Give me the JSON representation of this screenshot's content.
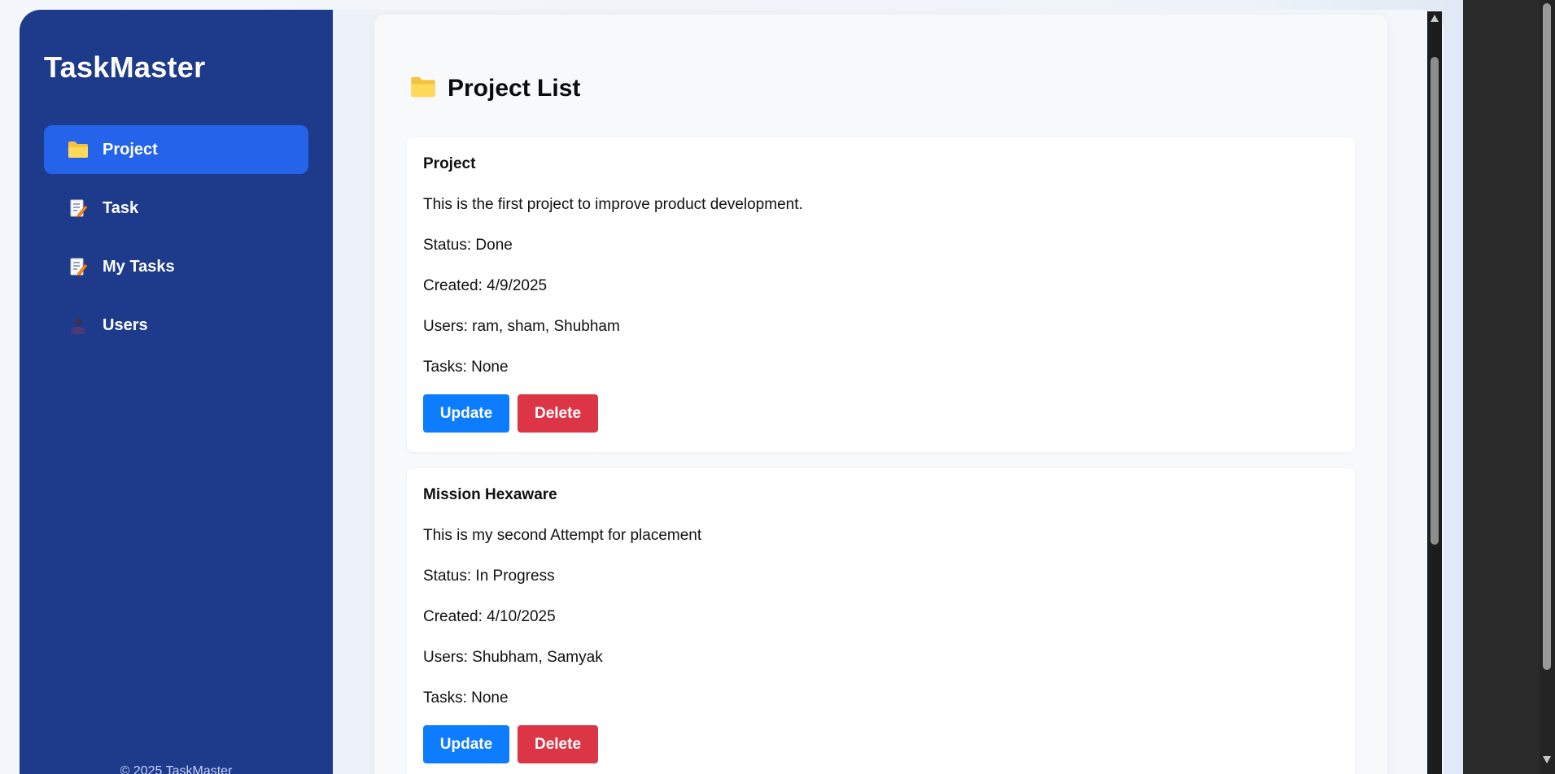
{
  "app": {
    "title": "TaskMaster",
    "footer": "© 2025 TaskMaster"
  },
  "sidebar": {
    "items": [
      {
        "label": "Project",
        "icon": "folder-icon",
        "active": true
      },
      {
        "label": "Task",
        "icon": "memo-icon",
        "active": false
      },
      {
        "label": "My Tasks",
        "icon": "memo-icon",
        "active": false
      },
      {
        "label": "Users",
        "icon": "user-icon",
        "active": false
      }
    ]
  },
  "main": {
    "heading": "Project List",
    "heading_icon": "folder-icon",
    "projects": [
      {
        "name": "Project",
        "description": "This is the first project to improve product development.",
        "status": "Status: Done",
        "created": "Created: 4/9/2025",
        "users": "Users: ram, sham, Shubham",
        "tasks": "Tasks: None",
        "update_label": "Update",
        "delete_label": "Delete"
      },
      {
        "name": "Mission Hexaware",
        "description": "This is my second Attempt for placement",
        "status": "Status: In Progress",
        "created": "Created: 4/10/2025",
        "users": "Users: Shubham, Samyak",
        "tasks": "Tasks: None",
        "update_label": "Update",
        "delete_label": "Delete"
      }
    ]
  },
  "colors": {
    "sidebar_bg": "#1e3a8a",
    "active_nav": "#2563eb",
    "update_button": "#0d7cff",
    "delete_button": "#dc3545",
    "folder": "#f5c23c"
  }
}
